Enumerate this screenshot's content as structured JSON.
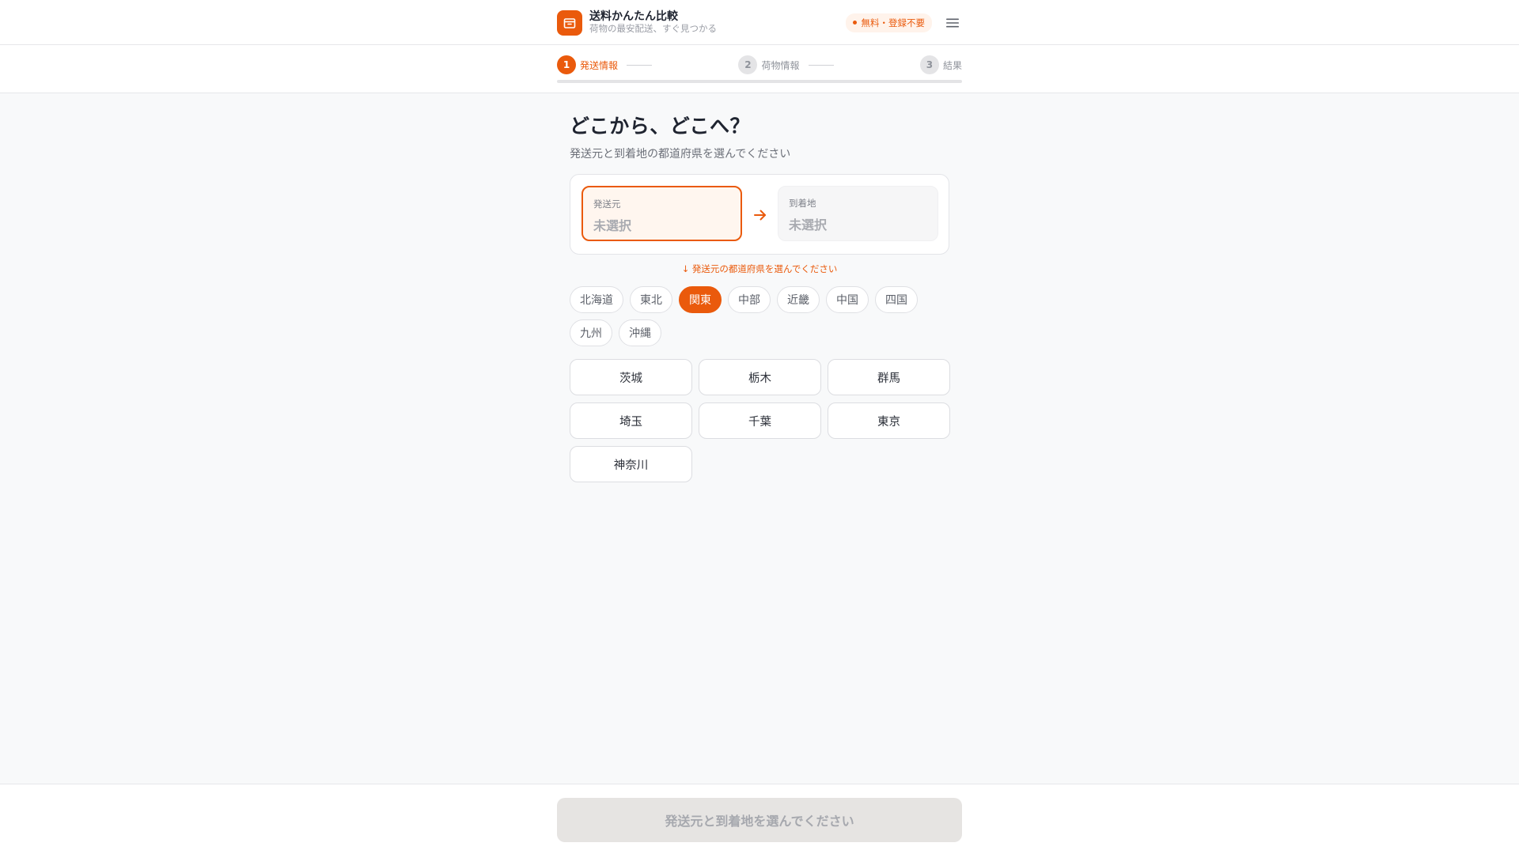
{
  "header": {
    "title": "送料かんたん比較",
    "subtitle": "荷物の最安配送、すぐ見つかる",
    "badge": "無料・登録不要",
    "logo_icon": "box-icon",
    "menu_icon": "hamburger-menu-icon"
  },
  "stepper": {
    "steps": [
      {
        "number": "1",
        "label": "発送情報",
        "state": "active"
      },
      {
        "number": "2",
        "label": "荷物情報",
        "state": "inactive"
      },
      {
        "number": "3",
        "label": "結果",
        "state": "inactive"
      }
    ],
    "progress_percent": 0
  },
  "main": {
    "title": "どこから、どこへ？",
    "subtitle": "発送元と到着地の都道府県を選んでください",
    "route": {
      "from_label": "発送元",
      "from_value": "未選択",
      "to_label": "到着地",
      "to_value": "未選択",
      "arrow_icon": "arrow-right-icon"
    },
    "hint": "↓ 発送元の都道府県を選んでください",
    "regions": [
      {
        "label": "北海道",
        "selected": false
      },
      {
        "label": "東北",
        "selected": false
      },
      {
        "label": "関東",
        "selected": true
      },
      {
        "label": "中部",
        "selected": false
      },
      {
        "label": "近畿",
        "selected": false
      },
      {
        "label": "中国",
        "selected": false
      },
      {
        "label": "四国",
        "selected": false
      },
      {
        "label": "九州",
        "selected": false
      },
      {
        "label": "沖縄",
        "selected": false
      }
    ],
    "prefectures": [
      "茨城",
      "栃木",
      "群馬",
      "埼玉",
      "千葉",
      "東京",
      "神奈川"
    ]
  },
  "footer": {
    "submit_label": "発送元と到着地を選んでください"
  },
  "colors": {
    "accent": "#ea5a0c",
    "accent_soft": "#fff6ef",
    "disabled_bg": "#e6e4e2"
  }
}
